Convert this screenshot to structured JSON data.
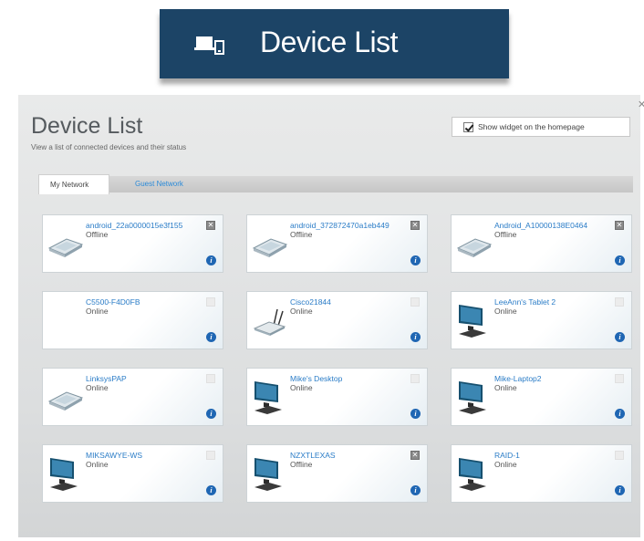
{
  "banner": {
    "title": "Device List",
    "icon": "devices-icon",
    "background": "#1c4466"
  },
  "widget": {
    "title": "Device List",
    "subtitle": "View a list of connected devices and their status",
    "show_on_homepage_label": "Show widget on the homepage",
    "show_on_homepage_checked": true
  },
  "tabs": [
    {
      "label": "My Network",
      "active": true
    },
    {
      "label": "Guest Network",
      "active": false
    }
  ],
  "devices": [
    {
      "name": "android_22a0000015e3f155",
      "status": "Offline",
      "icon": "router-device-icon",
      "removable": true
    },
    {
      "name": "android_372872470a1eb449",
      "status": "Offline",
      "icon": "router-device-icon",
      "removable": true
    },
    {
      "name": "Android_A10000138E0464",
      "status": "Offline",
      "icon": "router-device-icon",
      "removable": true
    },
    {
      "name": "C5500-F4D0FB",
      "status": "Online",
      "icon": "",
      "removable": false
    },
    {
      "name": "Cisco21844",
      "status": "Online",
      "icon": "wireless-router-icon",
      "removable": false
    },
    {
      "name": "LeeAnn's Tablet 2",
      "status": "Online",
      "icon": "desktop-computer-icon",
      "removable": false
    },
    {
      "name": "LinksysPAP",
      "status": "Online",
      "icon": "router-device-icon",
      "removable": false
    },
    {
      "name": "Mike's Desktop",
      "status": "Online",
      "icon": "desktop-computer-icon",
      "removable": false
    },
    {
      "name": "Mike-Laptop2",
      "status": "Online",
      "icon": "desktop-computer-icon",
      "removable": false
    },
    {
      "name": "MIKSAWYE-WS",
      "status": "Online",
      "icon": "desktop-computer-icon",
      "removable": false
    },
    {
      "name": "NZXTLEXAS",
      "status": "Offline",
      "icon": "desktop-computer-icon",
      "removable": true
    },
    {
      "name": "RAID-1",
      "status": "Online",
      "icon": "desktop-computer-icon",
      "removable": false
    }
  ],
  "colors": {
    "link": "#2a7cc7",
    "info_button": "#1f66b3"
  }
}
